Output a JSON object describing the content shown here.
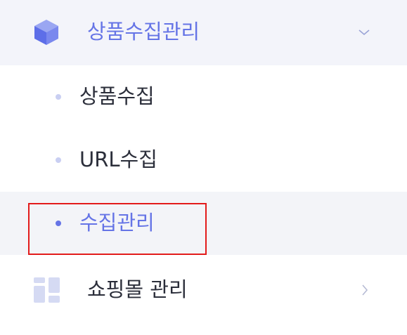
{
  "menu": {
    "header": {
      "label": "상품수집관리",
      "icon": "cube-icon",
      "expanded": true,
      "accent": "#6574e6"
    },
    "sub_items": [
      {
        "label": "상품수집",
        "active": false
      },
      {
        "label": "URL수집",
        "active": false
      },
      {
        "label": "수집관리",
        "active": true
      }
    ],
    "shop": {
      "label": "쇼핑몰 관리",
      "icon": "grid-icon"
    }
  }
}
